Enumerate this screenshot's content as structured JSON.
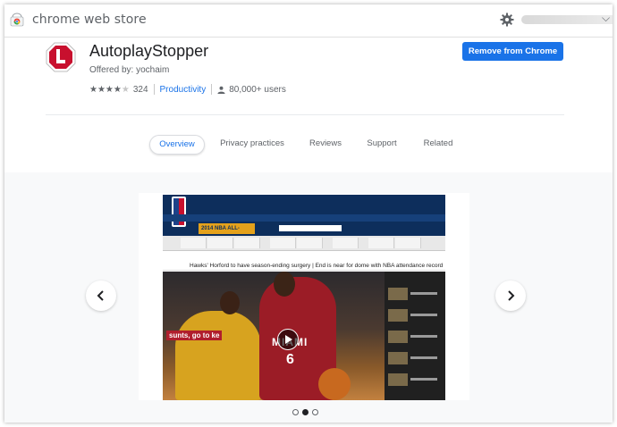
{
  "topbar": {
    "store_name": "chrome web store",
    "logo_icon": "chrome-web-store-logo",
    "settings_icon": "gear-icon",
    "account_caret": "⌵"
  },
  "extension": {
    "name": "AutoplayStopper",
    "offered_by": "Offered by: yochaim",
    "rating_stars": 4,
    "rating_count": "324",
    "category": "Productivity",
    "users": "80,000+ users",
    "action_button": "Remove from Chrome"
  },
  "tabs": [
    {
      "label": "Overview",
      "active": true
    },
    {
      "label": "Privacy practices",
      "active": false
    },
    {
      "label": "Reviews",
      "active": false
    },
    {
      "label": "Support",
      "active": false
    },
    {
      "label": "Related",
      "active": false
    }
  ],
  "gallery": {
    "current_slide": 2,
    "total_slides": 3,
    "screenshot": {
      "headline": "Hawks' Horford to have season-ending surgery  |  End is near for dome with NBA attendance record",
      "allstar_banner": "2014 NBA ALL-STARS",
      "jersey_text": "MIAMI",
      "jersey_number": "6",
      "overlay_text": "sunts, go to ke"
    }
  },
  "colors": {
    "accent": "#1a73e8",
    "icon_red": "#c8102e"
  }
}
